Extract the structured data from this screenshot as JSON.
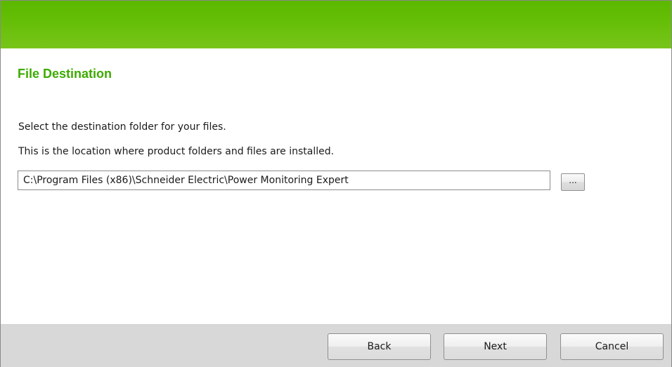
{
  "header": {
    "title": "File Destination"
  },
  "content": {
    "instruction": "Select the destination folder for your files.",
    "description": "This is the location where product folders and files are installed."
  },
  "destination": {
    "path": "C:\\Program Files (x86)\\Schneider Electric\\Power Monitoring Expert",
    "browse_label": "..."
  },
  "footer": {
    "back_label": "Back",
    "next_label": "Next",
    "cancel_label": "Cancel"
  },
  "colors": {
    "banner": "#62bd04",
    "title": "#3dab00",
    "footer": "#d8d8d8"
  }
}
